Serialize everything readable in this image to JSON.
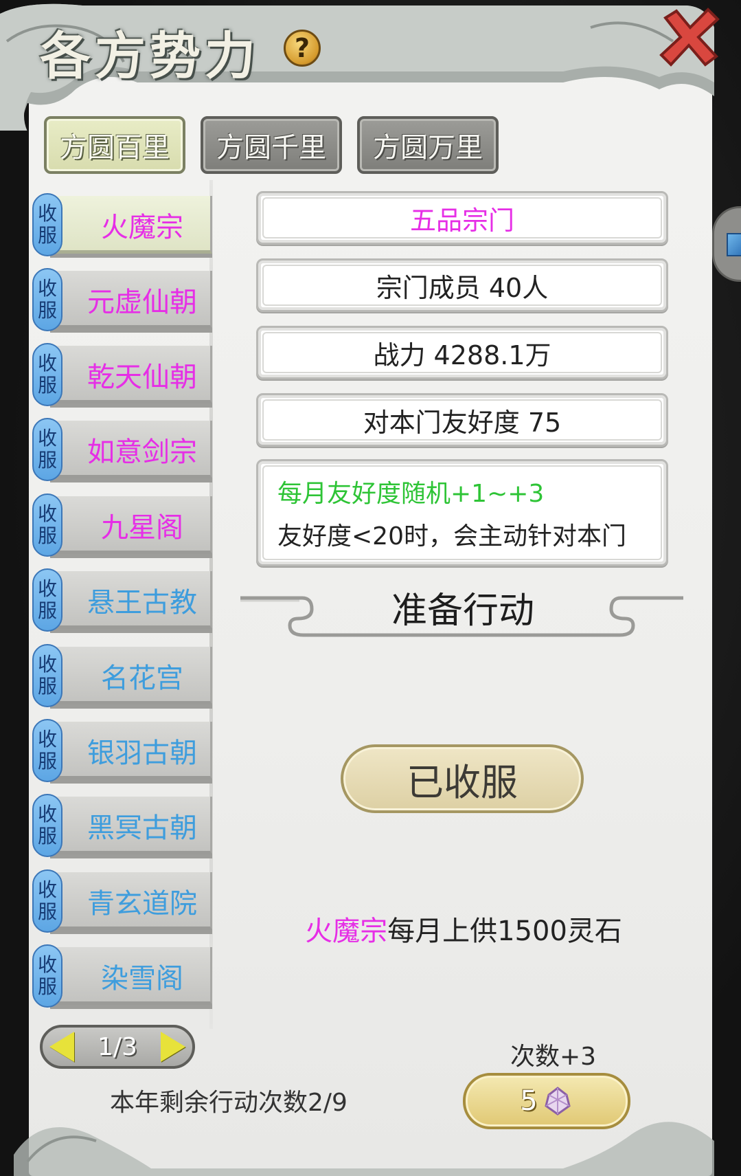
{
  "header": {
    "title": "各方势力",
    "help_label": "?"
  },
  "tabs": [
    {
      "label": "方圆百里",
      "active": true
    },
    {
      "label": "方圆千里",
      "active": false
    },
    {
      "label": "方圆万里",
      "active": false
    }
  ],
  "sect_list": {
    "badge_top": "收",
    "badge_bottom": "服",
    "items": [
      {
        "name": "火魔宗",
        "color": "#e62ee6",
        "selected": true
      },
      {
        "name": "元虚仙朝",
        "color": "#e62ee6"
      },
      {
        "name": "乾天仙朝",
        "color": "#e62ee6"
      },
      {
        "name": "如意剑宗",
        "color": "#e62ee6"
      },
      {
        "name": "九星阁",
        "color": "#e62ee6"
      },
      {
        "name": "悬王古教",
        "color": "#3e9ddd"
      },
      {
        "name": "名花宫",
        "color": "#3e9ddd"
      },
      {
        "name": "银羽古朝",
        "color": "#3e9ddd"
      },
      {
        "name": "黑冥古朝",
        "color": "#3e9ddd"
      },
      {
        "name": "青玄道院",
        "color": "#3e9ddd"
      },
      {
        "name": "染雪阁",
        "color": "#3e9ddd"
      }
    ]
  },
  "pager": {
    "text": "1/3"
  },
  "remaining_actions": "本年剩余行动次数2/9",
  "details": {
    "grade": "五品宗门",
    "members": "宗门成员 40人",
    "power": "战力 4288.1万",
    "friendship": "对本门友好度 75",
    "desc_green": "每月友好度随机+1~+3",
    "desc_black": "友好度<20时，会主动针对本门"
  },
  "section_title": "准备行动",
  "conquered_button": "已收服",
  "tribute": {
    "sect": "火魔宗",
    "text": "每月上供1500灵石"
  },
  "extra_times": {
    "label": "次数+3",
    "cost": "5",
    "cost_icon": "spirit-gem-icon"
  },
  "colors": {
    "sect_magenta": "#e62ee6",
    "sect_blue": "#3e9ddd",
    "desc_green": "#2ec436"
  }
}
